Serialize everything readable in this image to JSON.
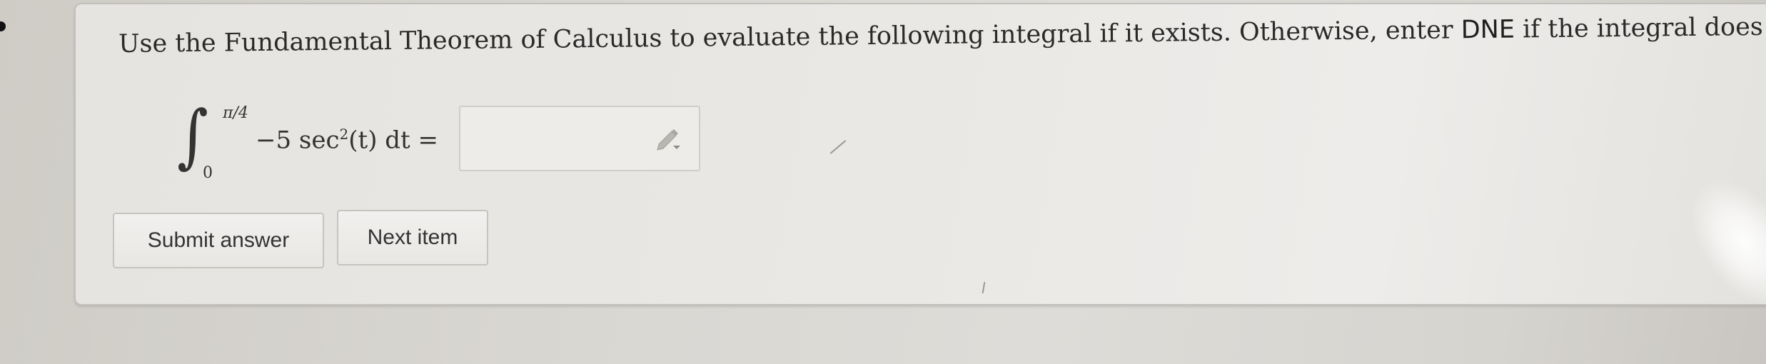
{
  "question": {
    "text_before": "Use the Fundamental Theorem of Calculus to evaluate the following integral if it exists. Otherwise, enter ",
    "dne": "DNE",
    "text_after": " if the integral does not exis"
  },
  "integral": {
    "upper_limit": "π/4",
    "lower_limit": "0",
    "integrand_prefix": "−5 sec",
    "exponent": "2",
    "integrand_suffix": "(t) dt ="
  },
  "answer": {
    "value": ""
  },
  "buttons": {
    "submit": "Submit answer",
    "next": "Next item"
  },
  "icons": {
    "pencil": "pencil-icon"
  }
}
